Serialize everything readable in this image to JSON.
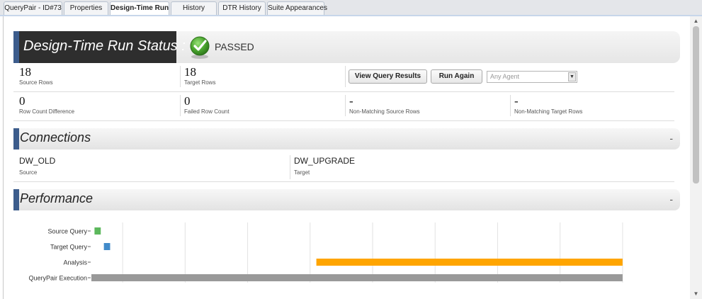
{
  "tabs": [
    {
      "label": "QueryPair - ID#73",
      "active": false
    },
    {
      "label": "Properties",
      "active": false
    },
    {
      "label": "Design-Time Run",
      "active": true
    },
    {
      "label": "History",
      "active": false
    },
    {
      "label": "DTR History",
      "active": false
    },
    {
      "label": "Suite Appearances",
      "active": false
    }
  ],
  "status": {
    "title": "Design-Time Run Status :",
    "result": "PASSED",
    "icon": "green-check-icon"
  },
  "stats": {
    "source_rows": {
      "value": "18",
      "label": "Source Rows"
    },
    "target_rows": {
      "value": "18",
      "label": "Target Rows"
    },
    "row_count_difference": {
      "value": "0",
      "label": "Row Count Difference"
    },
    "failed_row_count": {
      "value": "0",
      "label": "Failed Row Count"
    },
    "non_matching_source_rows": {
      "value": "-",
      "label": "Non-Matching Source Rows"
    },
    "non_matching_target_rows": {
      "value": "-",
      "label": "Non-Matching Target Rows"
    }
  },
  "actions": {
    "view_query_results": "View Query Results",
    "run_again": "Run Again",
    "agent_select_placeholder": "Any Agent"
  },
  "connections": {
    "title": "Connections",
    "collapse": "-",
    "source": {
      "value": "DW_OLD",
      "label": "Source"
    },
    "target": {
      "value": "DW_UPGRADE",
      "label": "Target"
    }
  },
  "performance": {
    "title": "Performance",
    "collapse": "-"
  },
  "colors": {
    "source_query": "#5cb85c",
    "target_query": "#428bca",
    "analysis": "#ffa500",
    "execution": "#999999",
    "section_accent": "#3c5c8c"
  },
  "chart_data": {
    "type": "gantt",
    "categories": [
      "Source Query",
      "Target Query",
      "Analysis",
      "QueryPair Execution"
    ],
    "series": [
      {
        "category": "Source Query",
        "start": 0.05,
        "end": 0.15,
        "color": "#5cb85c"
      },
      {
        "category": "Target Query",
        "start": 0.2,
        "end": 0.3,
        "color": "#428bca"
      },
      {
        "category": "Analysis",
        "start": 3.6,
        "end": 8.5,
        "color": "#ffa500"
      },
      {
        "category": "QueryPair Execution",
        "start": 0,
        "end": 8.5,
        "color": "#999999"
      }
    ],
    "xlim": [
      0,
      9
    ],
    "grid": true
  }
}
